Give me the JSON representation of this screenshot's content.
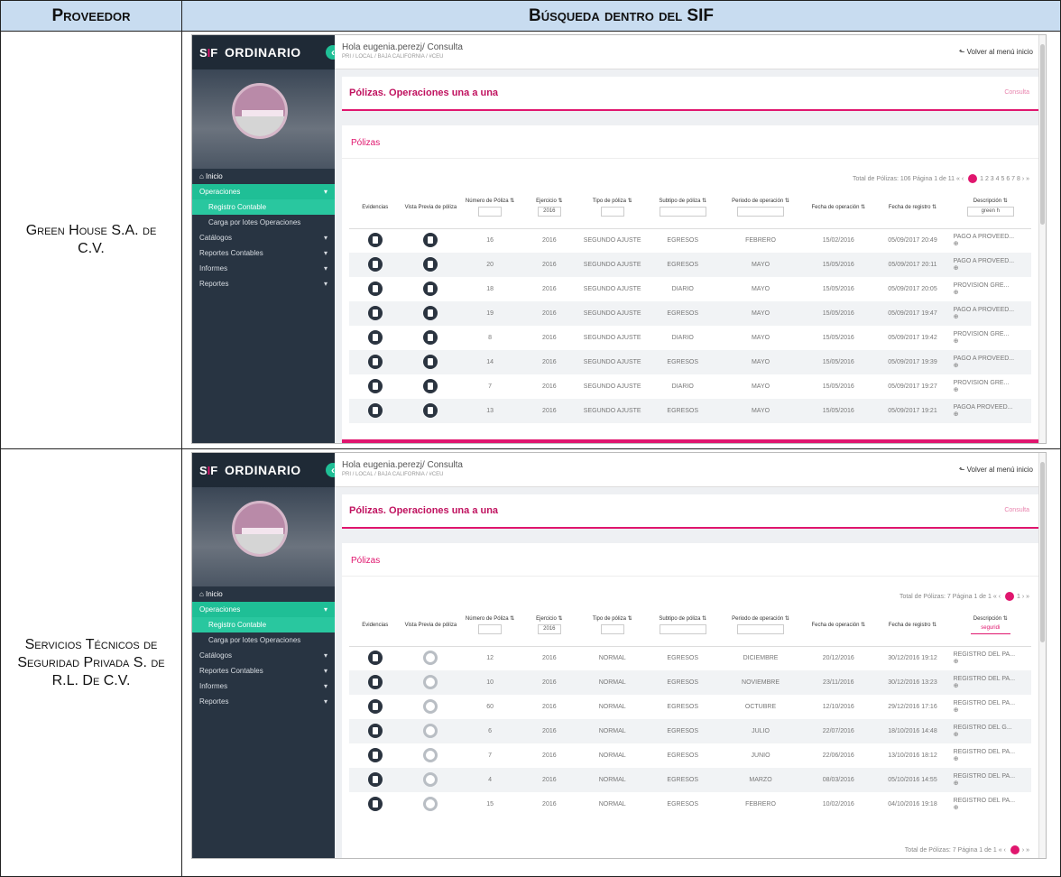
{
  "table": {
    "header_provider": "Proveedor",
    "header_search": "Búsqueda dentro del SIF"
  },
  "rows": [
    {
      "provider": "Green House S.A. de C.V.",
      "screenshot": {
        "brand": "ORDINARIO",
        "greeting": "Hola eugenia.perezj/ Consulta",
        "greeting_sub": "PRI / LOCAL / BAJA CALIFORNIA / #CEU",
        "back_link": "Volver al menú inicio",
        "page_title": "Pólizas. Operaciones una a una",
        "crumb": "Consulta",
        "card_title": "Pólizas",
        "pager_text": "Total de Pólizas: 106   Página 1 de 11",
        "pager_pages": "1 2 3 4 5 6 7 8",
        "menu": [
          "Inicio",
          "Operaciones",
          "Registro Contable",
          "Carga por lotes Operaciones",
          "Catálogos",
          "Reportes Contables",
          "Informes",
          "Reportes"
        ],
        "columns": [
          "Evidencias",
          "Vista Previa de póliza",
          "Número de Póliza",
          "Ejercicio",
          "Tipo de póliza",
          "Subtipo de póliza",
          "Periodo de operación",
          "Fecha de operación",
          "Fecha de registro",
          "Descripción"
        ],
        "filter_year": "2016",
        "filter_desc": "green h",
        "data": [
          {
            "num": "16",
            "year": "2016",
            "tipo": "SEGUNDO AJUSTE",
            "subtipo": "EGRESOS",
            "periodo": "FEBRERO",
            "fop": "15/02/2016",
            "freg": "05/09/2017 20:49",
            "desc": "PAGO A PROVEED..."
          },
          {
            "num": "20",
            "year": "2016",
            "tipo": "SEGUNDO AJUSTE",
            "subtipo": "EGRESOS",
            "periodo": "MAYO",
            "fop": "15/05/2016",
            "freg": "05/09/2017 20:11",
            "desc": "PAGO A PROVEED..."
          },
          {
            "num": "18",
            "year": "2016",
            "tipo": "SEGUNDO AJUSTE",
            "subtipo": "DIARIO",
            "periodo": "MAYO",
            "fop": "15/05/2016",
            "freg": "05/09/2017 20:05",
            "desc": "PROVISION GRE..."
          },
          {
            "num": "19",
            "year": "2016",
            "tipo": "SEGUNDO AJUSTE",
            "subtipo": "EGRESOS",
            "periodo": "MAYO",
            "fop": "15/05/2016",
            "freg": "05/09/2017 19:47",
            "desc": "PAGO A PROVEED..."
          },
          {
            "num": "8",
            "year": "2016",
            "tipo": "SEGUNDO AJUSTE",
            "subtipo": "DIARIO",
            "periodo": "MAYO",
            "fop": "15/05/2016",
            "freg": "05/09/2017 19:42",
            "desc": "PROVISION GRE..."
          },
          {
            "num": "14",
            "year": "2016",
            "tipo": "SEGUNDO AJUSTE",
            "subtipo": "EGRESOS",
            "periodo": "MAYO",
            "fop": "15/05/2016",
            "freg": "05/09/2017 19:39",
            "desc": "PAGO A PROVEED..."
          },
          {
            "num": "7",
            "year": "2016",
            "tipo": "SEGUNDO AJUSTE",
            "subtipo": "DIARIO",
            "periodo": "MAYO",
            "fop": "15/05/2016",
            "freg": "05/09/2017 19:27",
            "desc": "PROVISION GRE..."
          },
          {
            "num": "13",
            "year": "2016",
            "tipo": "SEGUNDO AJUSTE",
            "subtipo": "EGRESOS",
            "periodo": "MAYO",
            "fop": "15/05/2016",
            "freg": "05/09/2017 19:21",
            "desc": "PAGOA PROVEED..."
          }
        ]
      }
    },
    {
      "provider": "Servicios Técnicos de Seguridad Privada S. de R.L. De C.V.",
      "screenshot": {
        "brand": "ORDINARIO",
        "greeting": "Hola eugenia.perezj/ Consulta",
        "greeting_sub": "PRI / LOCAL / BAJA CALIFORNIA / #CEU",
        "back_link": "Volver al menú inicio",
        "page_title": "Pólizas. Operaciones una a una",
        "crumb": "Consulta",
        "card_title": "Pólizas",
        "pager_text": "Total de Pólizas: 7   Página 1 de 1",
        "pager_pages": "1",
        "menu": [
          "Inicio",
          "Operaciones",
          "Registro Contable",
          "Carga por lotes Operaciones",
          "Catálogos",
          "Reportes Contables",
          "Informes",
          "Reportes"
        ],
        "columns": [
          "Evidencias",
          "Vista Previa de póliza",
          "Número de Póliza",
          "Ejercicio",
          "Tipo de póliza",
          "Subtipo de póliza",
          "Periodo de operación",
          "Fecha de operación",
          "Fecha de registro",
          "Descripción"
        ],
        "filter_year": "2016",
        "filter_desc": "seguridi",
        "data": [
          {
            "num": "12",
            "year": "2016",
            "tipo": "NORMAL",
            "subtipo": "EGRESOS",
            "periodo": "DICIEMBRE",
            "fop": "20/12/2016",
            "freg": "30/12/2016 19:12",
            "desc": "REGISTRO DEL PA..."
          },
          {
            "num": "10",
            "year": "2016",
            "tipo": "NORMAL",
            "subtipo": "EGRESOS",
            "periodo": "NOVIEMBRE",
            "fop": "23/11/2016",
            "freg": "30/12/2016 13:23",
            "desc": "REGISTRO DEL PA..."
          },
          {
            "num": "60",
            "year": "2016",
            "tipo": "NORMAL",
            "subtipo": "EGRESOS",
            "periodo": "OCTUBRE",
            "fop": "12/10/2016",
            "freg": "29/12/2016 17:16",
            "desc": "REGISTRO DEL PA..."
          },
          {
            "num": "6",
            "year": "2016",
            "tipo": "NORMAL",
            "subtipo": "EGRESOS",
            "periodo": "JULIO",
            "fop": "22/07/2016",
            "freg": "18/10/2016 14:48",
            "desc": "REGISTRO DEL G..."
          },
          {
            "num": "7",
            "year": "2016",
            "tipo": "NORMAL",
            "subtipo": "EGRESOS",
            "periodo": "JUNIO",
            "fop": "22/06/2016",
            "freg": "13/10/2016 18:12",
            "desc": "REGISTRO DEL PA..."
          },
          {
            "num": "4",
            "year": "2016",
            "tipo": "NORMAL",
            "subtipo": "EGRESOS",
            "periodo": "MARZO",
            "fop": "08/03/2016",
            "freg": "05/10/2016 14:55",
            "desc": "REGISTRO DEL PA..."
          },
          {
            "num": "15",
            "year": "2016",
            "tipo": "NORMAL",
            "subtipo": "EGRESOS",
            "periodo": "FEBRERO",
            "fop": "10/02/2016",
            "freg": "04/10/2016 19:18",
            "desc": "REGISTRO DEL PA..."
          }
        ]
      }
    }
  ]
}
